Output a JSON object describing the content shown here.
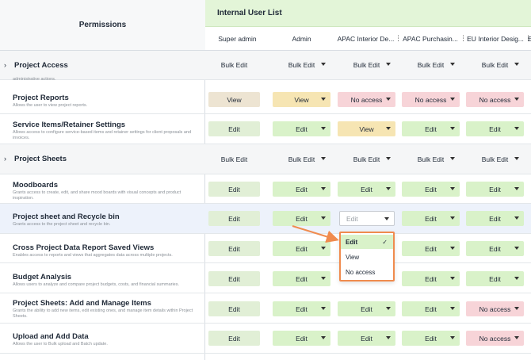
{
  "header": {
    "permissions_label": "Permissions",
    "list_title": "Internal User List"
  },
  "columns": [
    {
      "label": "Super admin"
    },
    {
      "label": "Admin"
    },
    {
      "label": "APAC Interior De..."
    },
    {
      "label": "APAC Purchasin..."
    },
    {
      "label": "EU Interior Desig..."
    },
    {
      "label": "E"
    }
  ],
  "rows": [
    {
      "kind": "section",
      "title": "Project Access",
      "cells": [
        "Bulk Edit",
        "Bulk Edit",
        "Bulk Edit",
        "Bulk Edit",
        "Bulk Edit"
      ]
    },
    {
      "kind": "row",
      "title": "Project Reports",
      "desc": "Allows the user to view project reports.",
      "cells": [
        "View",
        "View",
        "No access",
        "No access",
        "No access"
      ]
    },
    {
      "kind": "row",
      "title": "Service Items/Retainer Settings",
      "desc": "Allows access to configure service-based items and retainer settings for client proposals and invoices.",
      "cells": [
        "Edit",
        "Edit",
        "View",
        "Edit",
        "Edit"
      ]
    },
    {
      "kind": "section",
      "title": "Project Sheets",
      "cells": [
        "Bulk Edit",
        "Bulk Edit",
        "Bulk Edit",
        "Bulk Edit",
        "Bulk Edit"
      ]
    },
    {
      "kind": "row",
      "title": "Moodboards",
      "desc": "Grants access to create, edit, and share mood boards with visual concepts and product inspiration.",
      "cells": [
        "Edit",
        "Edit",
        "Edit",
        "Edit",
        "Edit"
      ]
    },
    {
      "kind": "row",
      "title": "Project sheet and Recycle bin",
      "desc": "Grants access to the project sheet and recycle bin.",
      "cells": [
        "Edit",
        "Edit",
        "Edit",
        "Edit",
        "Edit"
      ]
    },
    {
      "kind": "row",
      "title": "Cross Project Data Report Saved Views",
      "desc": "Enables access to reports and views that aggregates data across multiple projects.",
      "cells": [
        "Edit",
        "Edit",
        "",
        "Edit",
        "Edit"
      ]
    },
    {
      "kind": "row",
      "title": "Budget Analysis",
      "desc": "Allows users to analyze and compare project budgets, costs, and financial summaries.",
      "cells": [
        "Edit",
        "Edit",
        "",
        "Edit",
        "Edit"
      ]
    },
    {
      "kind": "row",
      "title": "Project Sheets: Add and Manage Items",
      "desc": "Grants the ability to add new items, edit existing ones, and manage item details within Project Sheets.",
      "cells": [
        "Edit",
        "Edit",
        "Edit",
        "Edit",
        "No access"
      ]
    },
    {
      "kind": "row",
      "title": "Upload and Add Data",
      "desc": "Allows the user to Bulk upload and Batch update.",
      "cells": [
        "Edit",
        "Edit",
        "Edit",
        "Edit",
        "No access"
      ]
    }
  ],
  "partial_top_text": "administrative actions.",
  "dropdown": {
    "current_value": "Edit",
    "options": [
      "Edit",
      "View",
      "No access"
    ],
    "selected": "Edit"
  },
  "colors": {
    "accent_arrow": "#f08b4e",
    "edit": "#d9f2c9",
    "view": "#f6e5b3",
    "no_access": "#f7d4d8"
  }
}
